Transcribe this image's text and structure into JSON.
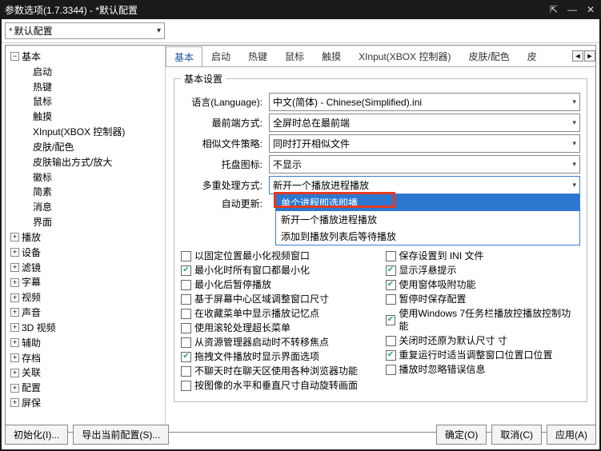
{
  "window": {
    "title": "参数选项(1.7.3344) - *默认配置",
    "btn_pin": "⇱",
    "btn_min": "—",
    "btn_close": "✕"
  },
  "config_selector": {
    "value": "默认配置"
  },
  "tree": {
    "root": "基本",
    "children_lvl1": [
      "启动",
      "热键",
      "鼠标",
      "触摸",
      "XInput(XBOX 控制器)",
      "皮肤/配色",
      "皮肤输出方式/放大",
      "徽标",
      "简素",
      "消息",
      "界面"
    ],
    "siblings": [
      "播放",
      "设备",
      "滤镜",
      "字幕",
      "视频",
      "声音",
      "3D 视频",
      "辅助",
      "存档",
      "关联",
      "配置",
      "屏保"
    ]
  },
  "tabs": {
    "items": [
      "基本",
      "启动",
      "热键",
      "鼠标",
      "触摸",
      "XInput(XBOX 控制器)",
      "皮肤/配色"
    ],
    "overflow": "皮",
    "active_index": 0,
    "scroll_left": "◄",
    "scroll_right": "►"
  },
  "form": {
    "legend": "基本设置",
    "lang_label": "语言(Language):",
    "lang_value": "中文(简体) - Chinese(Simplified).ini",
    "front_label": "最前端方式:",
    "front_value": "全屏时总在最前端",
    "similar_label": "相似文件策略:",
    "similar_value": "同时打开相似文件",
    "tray_label": "托盘图标:",
    "tray_value": "不显示",
    "multi_label": "多重处理方式:",
    "multi_value": "新开一个播放进程播放",
    "update_label": "自动更新:",
    "dropdown": {
      "opt1": "单个进程即选即播",
      "opt2": "新开一个播放进程播放",
      "opt3": "添加到播放列表后等待播放"
    }
  },
  "checks_left": [
    {
      "t": "以固定位置最小化视频窗口",
      "c": false
    },
    {
      "t": "最小化时所有窗口都最小化",
      "c": true
    },
    {
      "t": "最小化后暂停播放",
      "c": false
    },
    {
      "t": "基于屏幕中心区域调整窗口尺寸",
      "c": false
    },
    {
      "t": "在收藏菜单中显示播放记忆点",
      "c": false
    },
    {
      "t": "使用滚轮处理超长菜单",
      "c": false
    },
    {
      "t": "从资源管理器启动时不转移焦点",
      "c": false
    },
    {
      "t": "拖拽文件播放时显示界面选项",
      "c": true
    },
    {
      "t": "不聊天时在聊天区使用各种浏览器功能",
      "c": false
    },
    {
      "t": "按图像的水平和垂直尺寸自动旋转画面",
      "c": false
    }
  ],
  "checks_right": [
    {
      "t": "保存设置到 INI 文件",
      "c": false
    },
    {
      "t": "显示浮悬提示",
      "c": true
    },
    {
      "t": "使用窗体吸附功能",
      "c": true
    },
    {
      "t": "暂停时保存配置",
      "c": false
    },
    {
      "t": "使用Windows 7任务栏播放控播放控制功能",
      "c": true
    },
    {
      "t": "关闭时还原为默认尺寸      寸",
      "c": false
    },
    {
      "t": "重复运行时适当调整窗口位置口位置",
      "c": true
    },
    {
      "t": "播放时忽略错误信息",
      "c": false
    }
  ],
  "footer": {
    "init": "初始化(I)...",
    "export": "导出当前配置(S)...",
    "ok": "确定(O)",
    "cancel": "取消(C)",
    "apply": "应用(A)"
  }
}
